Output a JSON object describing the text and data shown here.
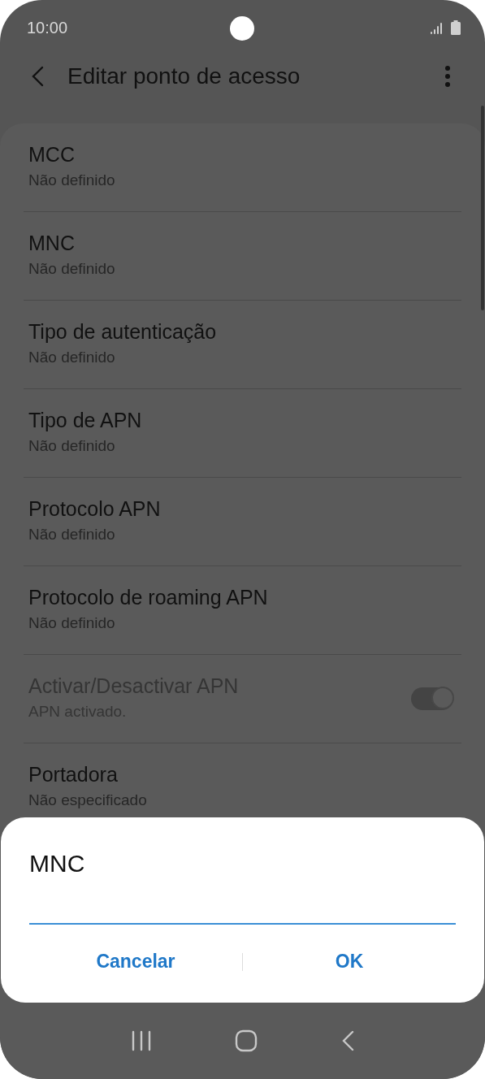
{
  "status_bar": {
    "time": "10:00"
  },
  "header": {
    "title": "Editar ponto de acesso"
  },
  "items": [
    {
      "kind": "text",
      "title": "MCC",
      "subtitle": "Não definido",
      "disabled": false
    },
    {
      "kind": "text",
      "title": "MNC",
      "subtitle": "Não definido",
      "disabled": false
    },
    {
      "kind": "text",
      "title": "Tipo de autenticação",
      "subtitle": "Não definido",
      "disabled": false
    },
    {
      "kind": "text",
      "title": "Tipo de APN",
      "subtitle": "Não definido",
      "disabled": false
    },
    {
      "kind": "text",
      "title": "Protocolo APN",
      "subtitle": "Não definido",
      "disabled": false
    },
    {
      "kind": "text",
      "title": "Protocolo de roaming APN",
      "subtitle": "Não definido",
      "disabled": false
    },
    {
      "kind": "switch",
      "title": "Activar/Desactivar APN",
      "subtitle": "APN activado.",
      "disabled": true,
      "on": true
    },
    {
      "kind": "text",
      "title": "Portadora",
      "subtitle": "Não especificado",
      "disabled": false
    }
  ],
  "dialog": {
    "title": "MNC",
    "buttons": [
      "Cancelar",
      "OK"
    ]
  }
}
